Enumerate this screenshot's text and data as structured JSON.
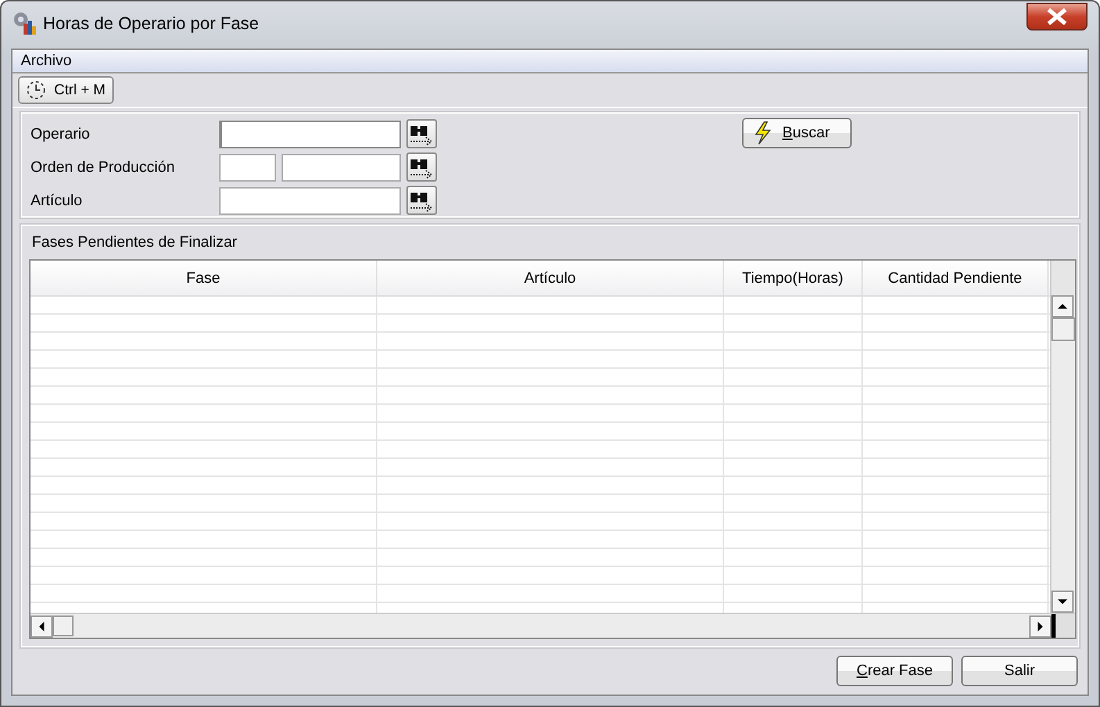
{
  "window": {
    "title": "Horas de Operario por Fase"
  },
  "menu": [
    "Archivo"
  ],
  "toolbar": [
    {
      "label": "Ctrl + M"
    }
  ],
  "filters": [
    {
      "label": "Operario",
      "kind": "single",
      "focused": true
    },
    {
      "label": "Orden de Producción",
      "kind": "double",
      "focused": false
    },
    {
      "label": "Artículo",
      "kind": "single",
      "focused": false
    }
  ],
  "search_button": {
    "label": "Buscar",
    "access_key": true
  },
  "group": {
    "title": "Fases Pendientes de Finalizar"
  },
  "table": {
    "columns": [
      "Fase",
      "Artículo",
      "Tiempo(Horas)",
      "Cantidad Pendiente"
    ]
  },
  "buttons": [
    {
      "label": "Crear Fase",
      "access_key": true
    },
    {
      "label": "Salir",
      "access_key": false
    }
  ]
}
